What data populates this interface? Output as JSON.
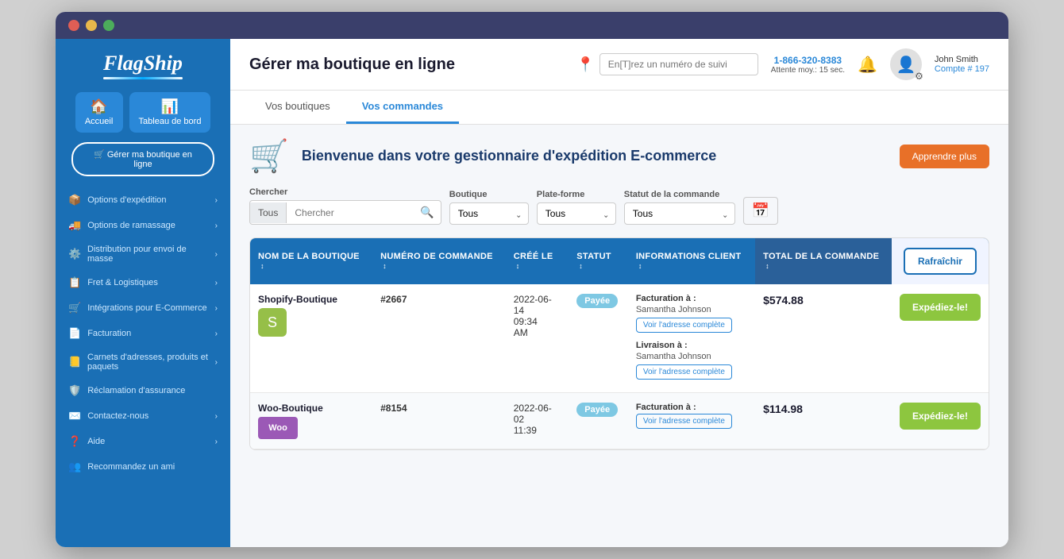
{
  "browser": {
    "dots": [
      "red",
      "yellow",
      "green"
    ]
  },
  "sidebar": {
    "logo": "FlagShip",
    "nav_buttons": [
      {
        "label": "Accueil",
        "icon": "🏠",
        "id": "accueil"
      },
      {
        "label": "Tableau de bord",
        "icon": "📊",
        "id": "tableau-de-bord"
      }
    ],
    "main_action": "🛒 Gérer ma boutique en ligne",
    "items": [
      {
        "label": "Options d'expédition",
        "icon": "📦",
        "id": "options-expedition",
        "has_chevron": true
      },
      {
        "label": "Options de ramassage",
        "icon": "🚚",
        "id": "options-ramassage",
        "has_chevron": true
      },
      {
        "label": "Distribution pour envoi de masse",
        "icon": "⚙️",
        "id": "distribution",
        "has_chevron": true
      },
      {
        "label": "Fret & Logistiques",
        "icon": "📋",
        "id": "fret",
        "has_chevron": true
      },
      {
        "label": "Intégrations pour E-Commerce",
        "icon": "🛒",
        "id": "integrations",
        "has_chevron": true
      },
      {
        "label": "Facturation",
        "icon": "📄",
        "id": "facturation",
        "has_chevron": true
      },
      {
        "label": "Carnets d'adresses, produits et paquets",
        "icon": "📒",
        "id": "carnets",
        "has_chevron": true
      },
      {
        "label": "Réclamation d'assurance",
        "icon": "🛡️",
        "id": "reclamation",
        "has_chevron": false
      },
      {
        "label": "Contactez-nous",
        "icon": "✉️",
        "id": "contact",
        "has_chevron": true
      },
      {
        "label": "Aide",
        "icon": "❓",
        "id": "aide",
        "has_chevron": true
      },
      {
        "label": "Recommandez un ami",
        "icon": "👥",
        "id": "recommandez",
        "has_chevron": false
      }
    ]
  },
  "topbar": {
    "title": "Gérer ma boutique en ligne",
    "track_placeholder": "En[T]rez un numéro de suivi",
    "phone": "1-866-320-8383",
    "wait": "Attente moy.: 15 sec.",
    "user_name": "John Smith",
    "user_account": "Compte # 197"
  },
  "tabs": [
    {
      "label": "Vos boutiques",
      "id": "vos-boutiques",
      "active": false
    },
    {
      "label": "Vos commandes",
      "id": "vos-commandes",
      "active": true
    }
  ],
  "welcome": {
    "text": "Bienvenue dans votre gestionnaire d'expédition E-commerce",
    "learn_more": "Apprendre plus"
  },
  "search": {
    "chercher_label": "Chercher",
    "chercher_prefix": "Tous",
    "chercher_placeholder": "Chercher",
    "boutique_label": "Boutique",
    "boutique_value": "Tous",
    "plateforme_label": "Plate-forme",
    "plateforme_value": "Tous",
    "statut_label": "Statut de la commande",
    "statut_value": "Tous"
  },
  "table": {
    "columns": [
      {
        "label": "NOM DE LA BOUTIQUE",
        "id": "nom-boutique"
      },
      {
        "label": "NUMÉRO DE COMMANDE",
        "id": "num-commande"
      },
      {
        "label": "CRÉÉ LE",
        "id": "cree-le"
      },
      {
        "label": "STATUT",
        "id": "statut"
      },
      {
        "label": "INFORMATIONS CLIENT",
        "id": "info-client"
      },
      {
        "label": "TOTAL DE LA COMMANDE",
        "id": "total"
      },
      {
        "label": "Rafraîchir",
        "id": "actions"
      }
    ],
    "rows": [
      {
        "id": "row-1",
        "shop": "Shopify-Boutique",
        "shop_type": "shopify",
        "order_num": "#2667",
        "date": "2022-06-14\n09:34\nAM",
        "status": "Payée",
        "billing_label": "Facturation à :",
        "billing_name": "Samantha Johnson",
        "billing_btn": "Voir l'adresse complète",
        "delivery_label": "Livraison à :",
        "delivery_name": "Samantha Johnson",
        "delivery_btn": "Voir l'adresse complète",
        "total": "$574.88",
        "action": "Expédiez-le!"
      },
      {
        "id": "row-2",
        "shop": "Woo-Boutique",
        "shop_type": "woo",
        "order_num": "#8154",
        "date": "2022-06-02\n11:39",
        "status": "Payée",
        "billing_label": "Facturation à :",
        "billing_name": "",
        "billing_btn": "Voir l'adresse complète",
        "delivery_label": "",
        "delivery_name": "",
        "delivery_btn": "",
        "total": "$114.98",
        "action": "Expédiez-le!"
      }
    ]
  }
}
